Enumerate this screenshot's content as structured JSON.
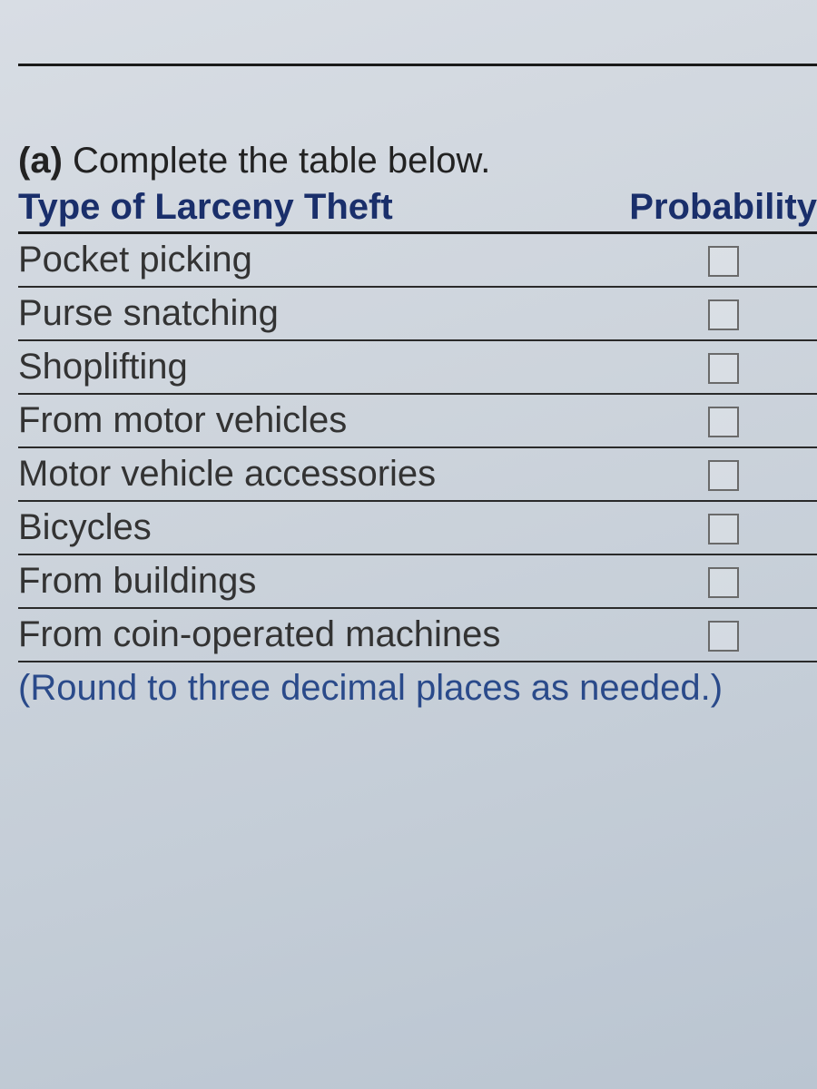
{
  "prompt": {
    "marker": "(a)",
    "text": "Complete the table below."
  },
  "table": {
    "headers": {
      "type": "Type of Larceny Theft",
      "probability": "Probability"
    },
    "rows": [
      {
        "type": "Pocket picking",
        "probability": ""
      },
      {
        "type": "Purse snatching",
        "probability": ""
      },
      {
        "type": "Shoplifting",
        "probability": ""
      },
      {
        "type": "From motor vehicles",
        "probability": ""
      },
      {
        "type": "Motor vehicle accessories",
        "probability": ""
      },
      {
        "type": "Bicycles",
        "probability": ""
      },
      {
        "type": "From buildings",
        "probability": ""
      },
      {
        "type": "From coin-operated machines",
        "probability": ""
      }
    ]
  },
  "hint": "(Round to three decimal places as needed.)"
}
